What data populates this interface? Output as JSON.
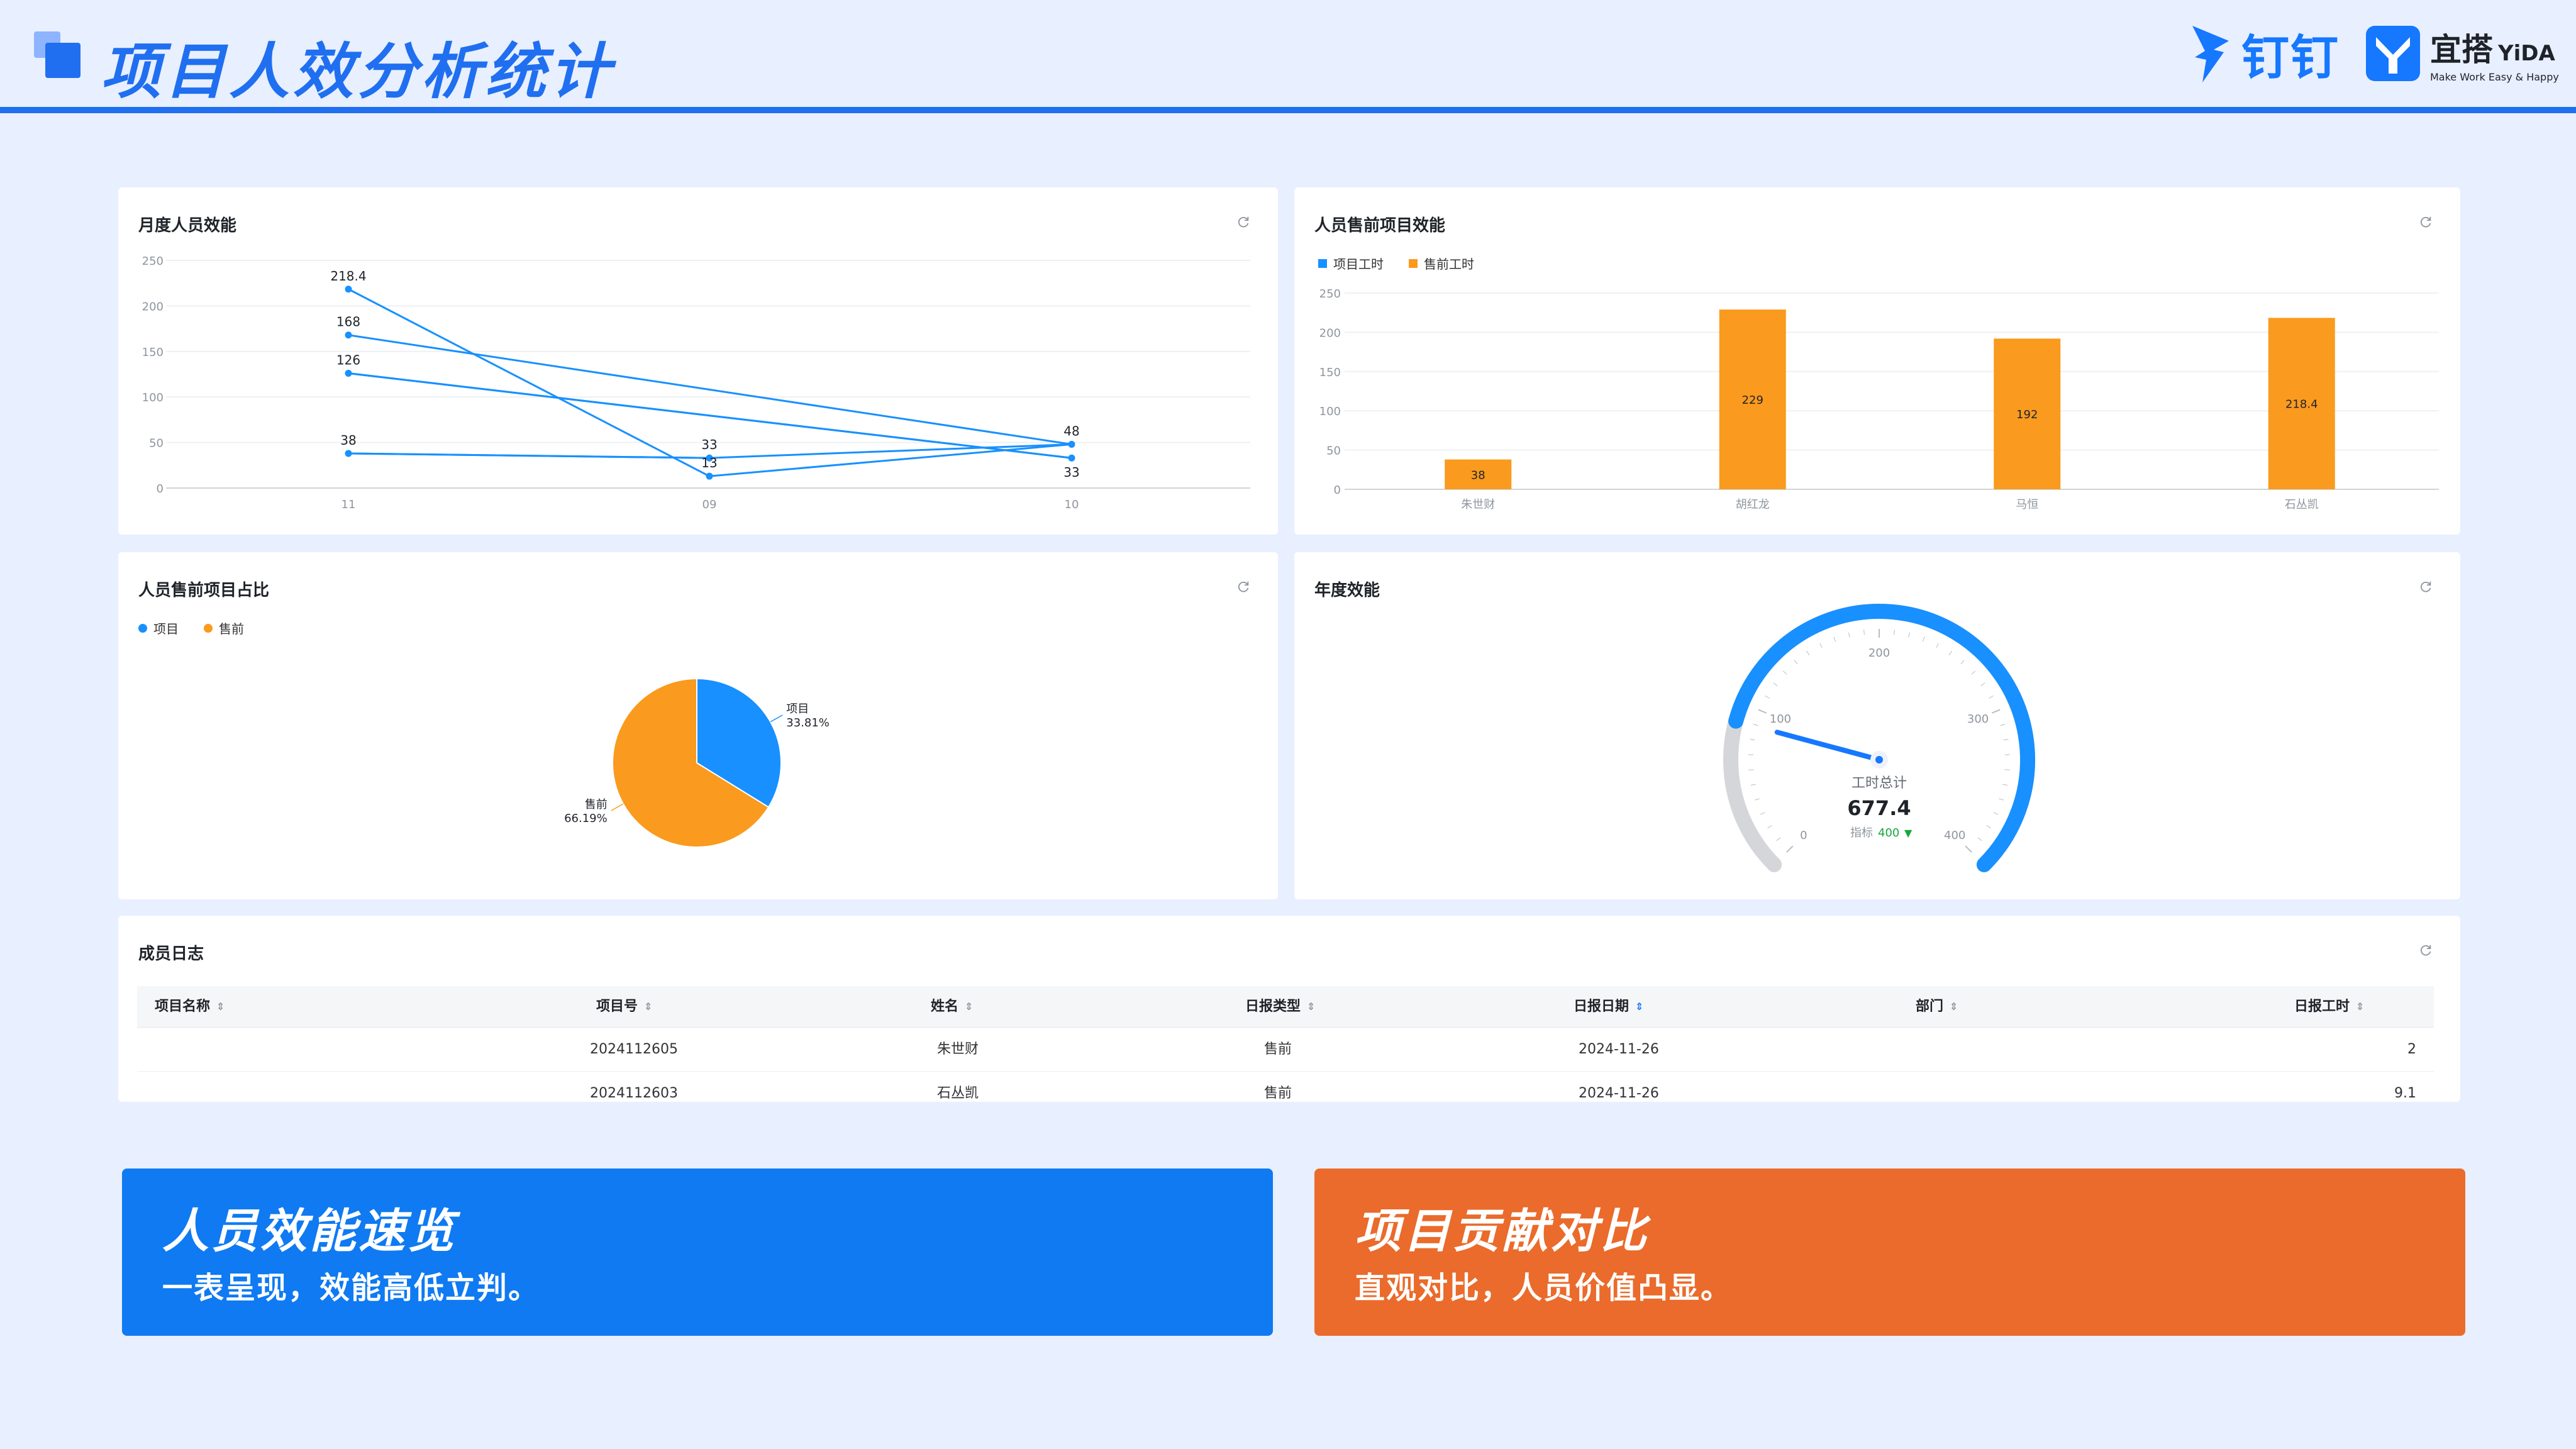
{
  "header": {
    "title": "项目人效分析统计",
    "brand_dingtalk": "钉钉",
    "brand_yida_cn": "宜搭",
    "brand_yida_en": "YiDA",
    "brand_yida_slogan": "Make Work Easy & Happy"
  },
  "colors": {
    "accent": "#1f6ff0",
    "blue": "#1890ff",
    "orange": "#fa9a1e",
    "card_blue": "#0f7af2",
    "card_orange": "#ea6b2b",
    "green": "#15a83b"
  },
  "panels": {
    "monthly": {
      "title": "月度人员效能",
      "refresh_icon": "refresh-icon"
    },
    "presales": {
      "title": "人员售前项目效能",
      "refresh_icon": "refresh-icon"
    },
    "ratio": {
      "title": "人员售前项目占比",
      "refresh_icon": "refresh-icon"
    },
    "annual": {
      "title": "年度效能",
      "refresh_icon": "refresh-icon"
    },
    "log": {
      "title": "成员日志",
      "refresh_icon": "refresh-icon"
    }
  },
  "chart_data": [
    {
      "id": "monthly",
      "type": "line",
      "title": "月度人员效能",
      "categories": [
        "11",
        "09",
        "10"
      ],
      "ylim": [
        0,
        250
      ],
      "yticks": [
        0,
        50,
        100,
        150,
        200,
        250
      ],
      "grid": true,
      "lines": [
        {
          "points": [
            [
              0,
              218.4
            ],
            [
              1,
              13
            ],
            [
              2,
              48
            ]
          ]
        },
        {
          "points": [
            [
              0,
              168
            ],
            [
              2,
              48
            ]
          ]
        },
        {
          "points": [
            [
              0,
              126
            ],
            [
              2,
              33
            ]
          ]
        },
        {
          "points": [
            [
              0,
              126
            ],
            [
              2,
              33
            ]
          ]
        },
        {
          "points": [
            [
              0,
              38
            ],
            [
              1,
              33
            ],
            [
              2,
              48
            ]
          ]
        },
        {
          "points": [
            [
              0,
              38
            ],
            [
              1,
              33
            ]
          ]
        }
      ],
      "labels": [
        {
          "x": 0,
          "y": 218.4,
          "text": "218.4",
          "pos": "above"
        },
        {
          "x": 0,
          "y": 168,
          "text": "168",
          "pos": "above"
        },
        {
          "x": 0,
          "y": 126,
          "text": "126",
          "pos": "above"
        },
        {
          "x": 0,
          "y": 38,
          "text": "38",
          "pos": "above"
        },
        {
          "x": 1,
          "y": 33,
          "text": "33",
          "pos": "above"
        },
        {
          "x": 1,
          "y": 13,
          "text": "13",
          "pos": "above"
        },
        {
          "x": 2,
          "y": 48,
          "text": "48",
          "pos": "above"
        },
        {
          "x": 2,
          "y": 33,
          "text": "33",
          "pos": "below"
        }
      ]
    },
    {
      "id": "presales",
      "type": "bar",
      "title": "人员售前项目效能",
      "categories": [
        "朱世财",
        "胡红龙",
        "马恒",
        "石丛凯"
      ],
      "ylim": [
        0,
        250
      ],
      "yticks": [
        0,
        50,
        100,
        150,
        200,
        250
      ],
      "grid": true,
      "legend": [
        "项目工时",
        "售前工时"
      ],
      "series": [
        {
          "name": "项目工时",
          "values": [
            0,
            0,
            0,
            0
          ]
        },
        {
          "name": "售前工时",
          "values": [
            38,
            229,
            192,
            218.4
          ]
        }
      ]
    },
    {
      "id": "ratio",
      "type": "pie",
      "title": "人员售前项目占比",
      "legend": [
        "项目",
        "售前"
      ],
      "slices": [
        {
          "name": "项目",
          "value": 33.81,
          "label": "33.81%"
        },
        {
          "name": "售前",
          "value": 66.19,
          "label": "66.19%"
        }
      ]
    },
    {
      "id": "annual",
      "type": "gauge",
      "title": "年度效能",
      "min": 0,
      "max": 400,
      "ticks": [
        0,
        100,
        200,
        300,
        400
      ],
      "value": 677.4,
      "needle_value": 89,
      "label": "工时总计",
      "value_text": "677.4",
      "target_label": "指标",
      "target_value": "400",
      "trend": "down"
    }
  ],
  "log_table": {
    "headers": [
      "项目名称",
      "项目号",
      "姓名",
      "日报类型",
      "日报日期",
      "部门",
      "日报工时"
    ],
    "active_sort": "日报日期",
    "rows": [
      [
        "",
        "2024112605",
        "朱世财",
        "售前",
        "2024-11-26",
        "",
        "2"
      ],
      [
        "",
        "2024112603",
        "石丛凯",
        "售前",
        "2024-11-26",
        "",
        "9.1"
      ]
    ]
  },
  "cards": [
    {
      "title": "人员效能速览",
      "subtitle": "一表呈现，效能高低立判。"
    },
    {
      "title": "项目贡献对比",
      "subtitle": "直观对比，人员价值凸显。"
    }
  ]
}
